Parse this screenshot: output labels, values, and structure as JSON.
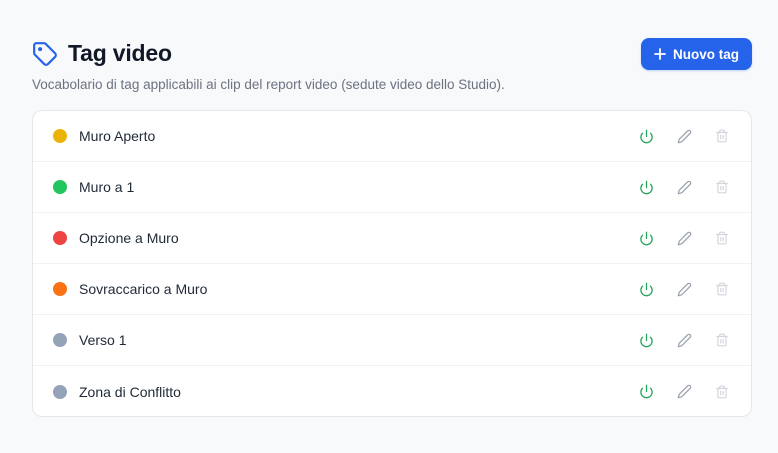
{
  "header": {
    "title": "Tag video",
    "subtitle": "Vocabolario di tag applicabili ai clip del report video (sedute video dello Studio).",
    "new_button_label": "Nuovo tag"
  },
  "colors": {
    "accent": "#2563eb",
    "power": "#22a55b",
    "edit": "#9ca3af",
    "delete": "#d1d5db"
  },
  "tags": [
    {
      "label": "Muro Aperto",
      "color": "#eab308"
    },
    {
      "label": "Muro a 1",
      "color": "#22c55e"
    },
    {
      "label": "Opzione a Muro",
      "color": "#ef4444"
    },
    {
      "label": "Sovraccarico a Muro",
      "color": "#f97316"
    },
    {
      "label": "Verso 1",
      "color": "#94a3b8"
    },
    {
      "label": "Zona di Conflitto",
      "color": "#94a3b8"
    }
  ]
}
